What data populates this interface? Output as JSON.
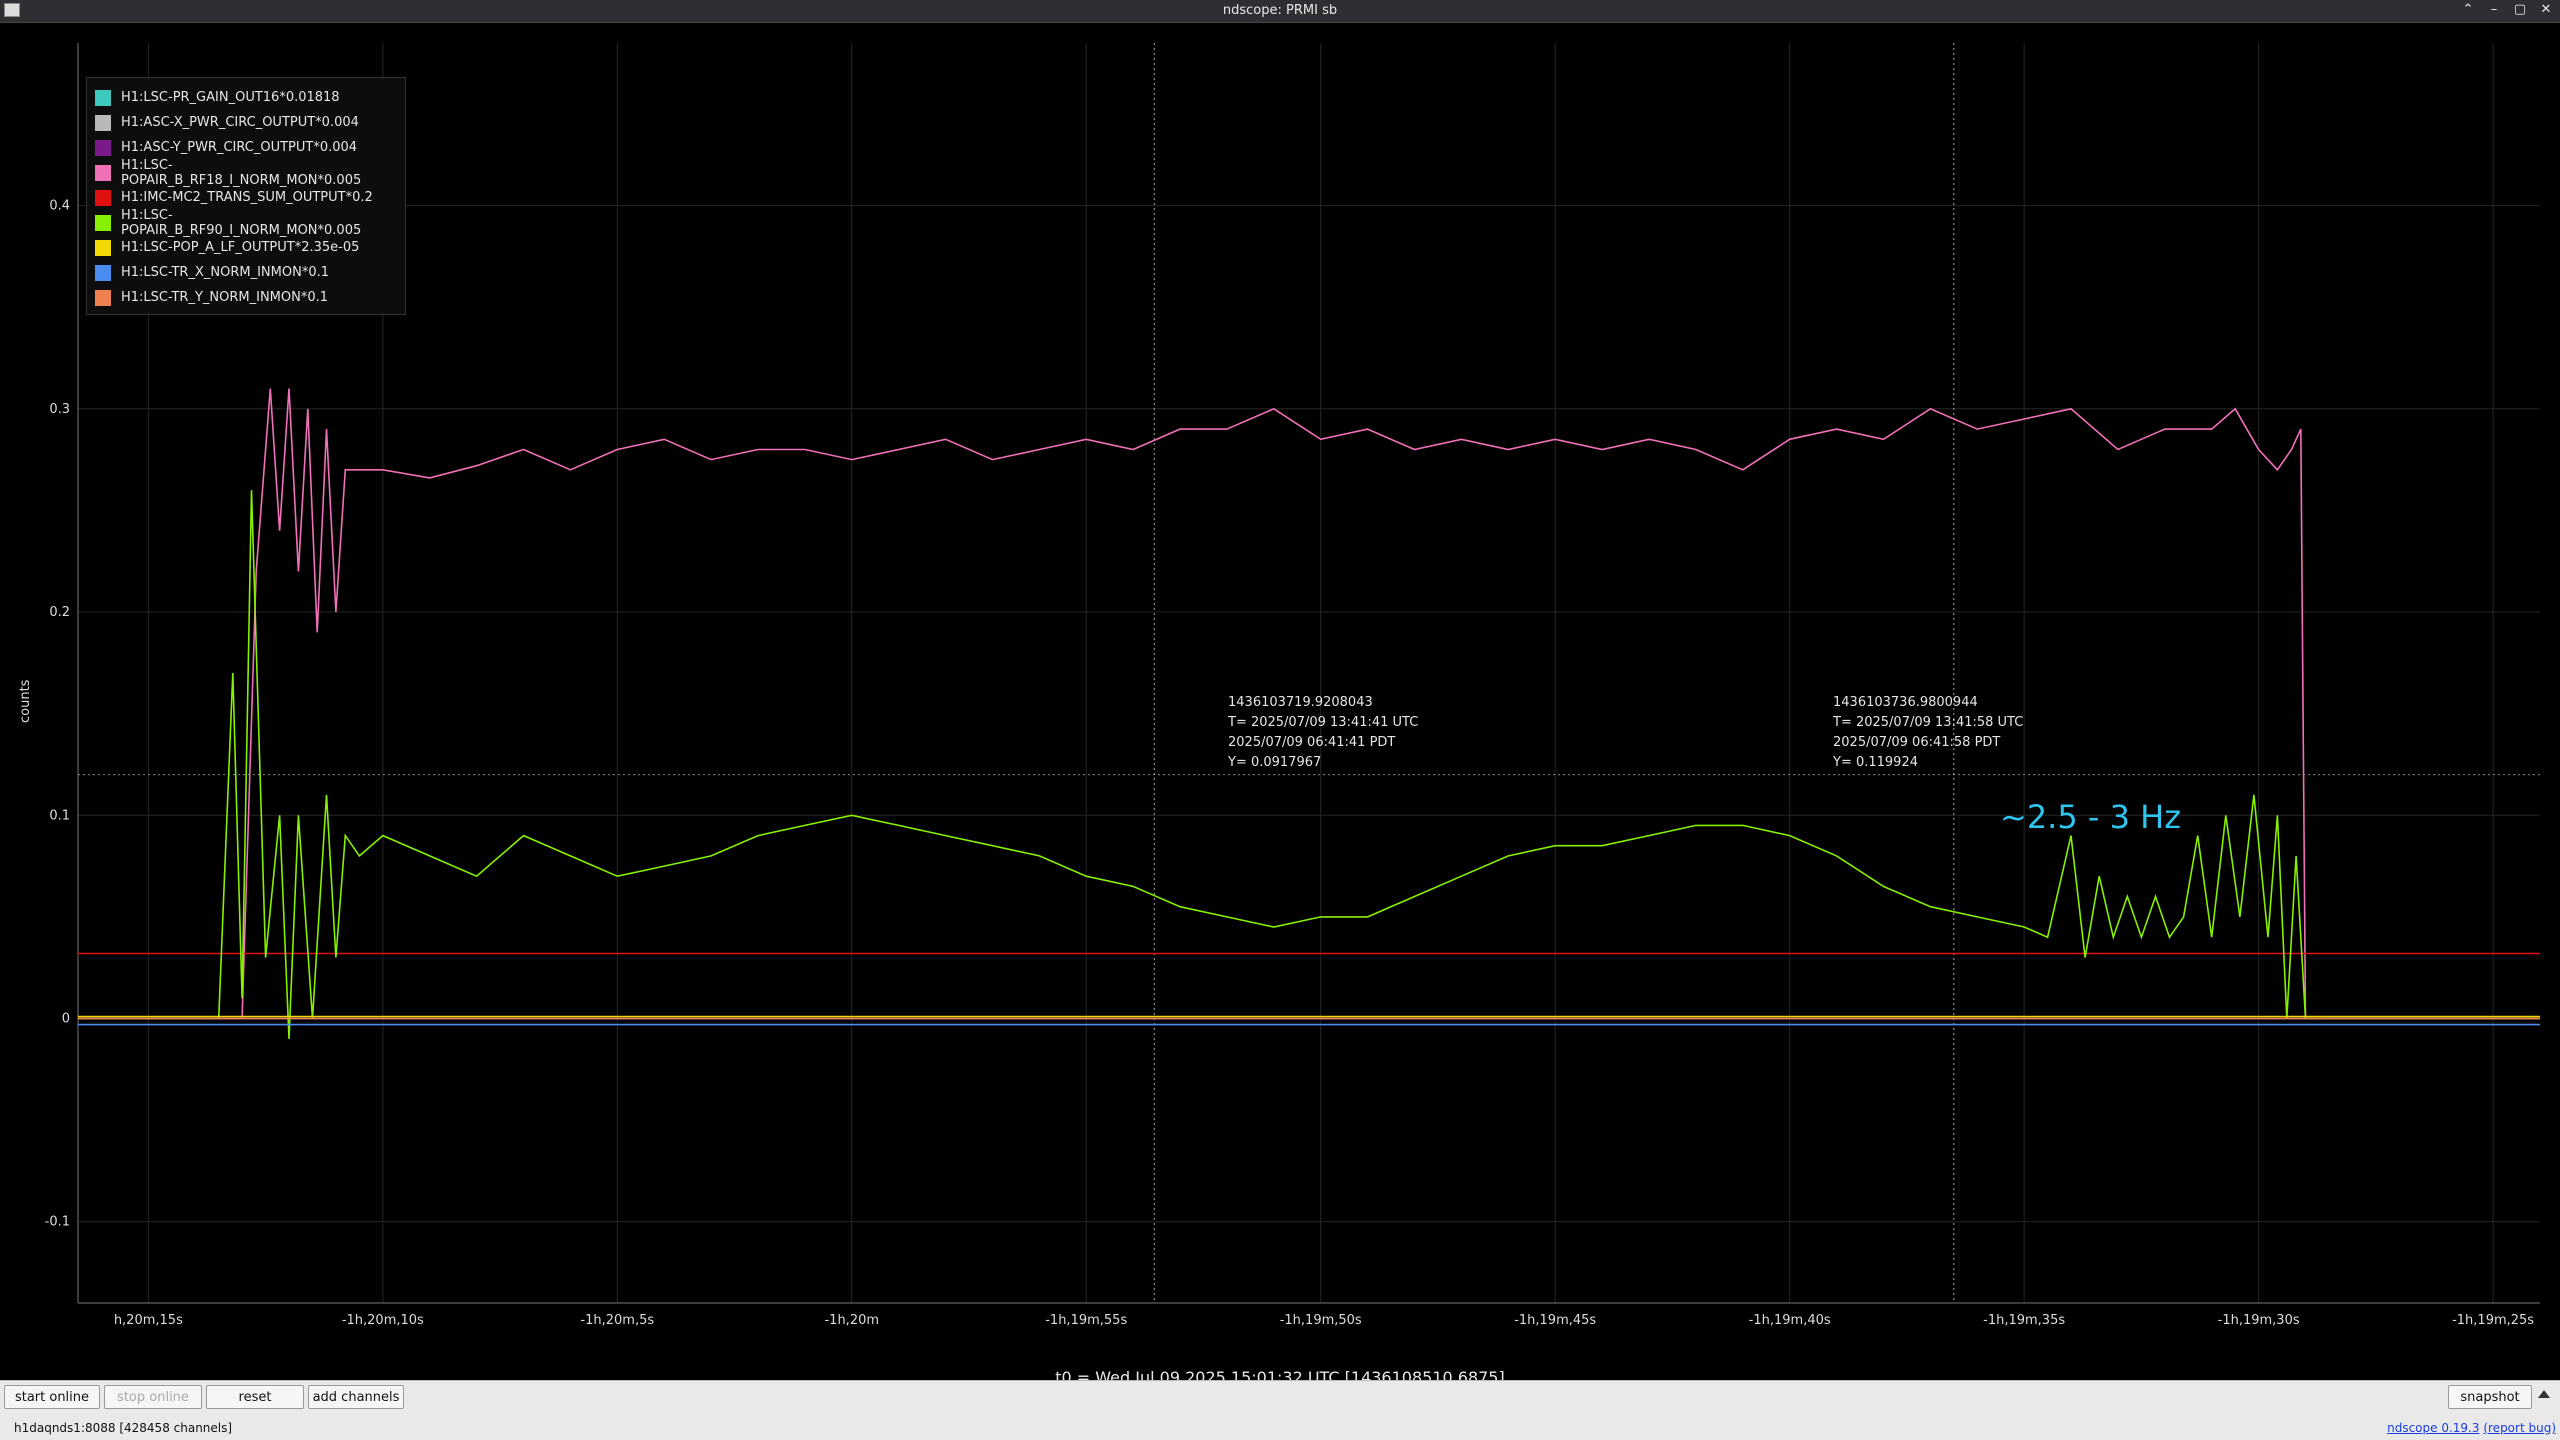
{
  "window": {
    "title": "ndscope: PRMI sb",
    "buttons": [
      "⌃",
      "–",
      "▢",
      "✕"
    ]
  },
  "chart_data": {
    "type": "line",
    "xlim": [
      -1216.5,
      -1164.0
    ],
    "ylim": [
      -0.14,
      0.48
    ],
    "ylabel": "counts",
    "yticks": [
      -0.1,
      0,
      0.1,
      0.2,
      0.3,
      0.4
    ],
    "ytick_labels": [
      "-0.1",
      "0",
      "0.1",
      "0.2",
      "0.3",
      "0.4"
    ],
    "xticks": [
      -1215,
      -1210,
      -1205,
      -1200,
      -1195,
      -1190,
      -1185,
      -1180,
      -1175,
      -1170,
      -1165
    ],
    "xtick_labels": [
      "h,20m,15s",
      "-1h,20m,10s",
      "-1h,20m,5s",
      "-1h,20m",
      "-1h,19m,55s",
      "-1h,19m,50s",
      "-1h,19m,45s",
      "-1h,19m,40s",
      "-1h,19m,35s",
      "-1h,19m,30s",
      "-1h,19m,25s"
    ],
    "grid": true,
    "legend_position": "top-left",
    "series": [
      {
        "name": "H1:LSC-PR_GAIN_OUT16*0.01818",
        "color": "#3ec9c0",
        "x": [
          -1216.5,
          -1164.0
        ],
        "y": [
          0.0,
          0.0
        ]
      },
      {
        "name": "H1:ASC-X_PWR_CIRC_OUTPUT*0.004",
        "color": "#b8b8b8",
        "x": [
          -1216.5,
          -1170.0,
          -1164.0
        ],
        "y": [
          0.0,
          0.0,
          0.0
        ]
      },
      {
        "name": "H1:ASC-Y_PWR_CIRC_OUTPUT*0.004",
        "color": "#7a1a8a",
        "x": [
          -1216.5,
          -1164.0
        ],
        "y": [
          0.0,
          0.0
        ]
      },
      {
        "name": "H1:LSC-POPAIR_B_RF18_I_NORM_MON*0.005",
        "color": "#f070b8",
        "x": [
          -1216.5,
          -1214.0,
          -1213.0,
          -1212.7,
          -1212.4,
          -1212.2,
          -1212.0,
          -1211.8,
          -1211.6,
          -1211.4,
          -1211.2,
          -1211.0,
          -1210.8,
          -1210.5,
          -1210.0,
          -1209.0,
          -1208.0,
          -1207.0,
          -1206.0,
          -1205.0,
          -1204.0,
          -1203.0,
          -1202.0,
          -1201.0,
          -1200.0,
          -1199.0,
          -1198.0,
          -1197.0,
          -1196.0,
          -1195.0,
          -1194.0,
          -1193.0,
          -1192.0,
          -1191.0,
          -1190.0,
          -1189.0,
          -1188.0,
          -1187.0,
          -1186.0,
          -1185.0,
          -1184.0,
          -1183.0,
          -1182.0,
          -1181.0,
          -1180.0,
          -1179.0,
          -1178.0,
          -1177.0,
          -1176.0,
          -1175.0,
          -1174.0,
          -1173.0,
          -1172.0,
          -1171.0,
          -1170.5,
          -1170.0,
          -1169.6,
          -1169.3,
          -1169.1,
          -1169.0,
          -1168.0,
          -1167.0,
          -1166.0,
          -1165.0,
          -1164.0
        ],
        "y": [
          0.0,
          0.0,
          0.0,
          0.22,
          0.31,
          0.24,
          0.31,
          0.22,
          0.3,
          0.19,
          0.29,
          0.2,
          0.27,
          0.27,
          0.27,
          0.266,
          0.272,
          0.28,
          0.27,
          0.28,
          0.285,
          0.275,
          0.28,
          0.28,
          0.275,
          0.28,
          0.285,
          0.275,
          0.28,
          0.285,
          0.28,
          0.29,
          0.29,
          0.3,
          0.285,
          0.29,
          0.28,
          0.285,
          0.28,
          0.285,
          0.28,
          0.285,
          0.28,
          0.27,
          0.285,
          0.29,
          0.285,
          0.3,
          0.29,
          0.295,
          0.3,
          0.28,
          0.29,
          0.29,
          0.3,
          0.28,
          0.27,
          0.28,
          0.29,
          0.0,
          0.0,
          0.0,
          0.0,
          0.0,
          0.0
        ]
      },
      {
        "name": "H1:IMC-MC2_TRANS_SUM_OUTPUT*0.2",
        "color": "#e01010",
        "x": [
          -1216.5,
          -1164.0
        ],
        "y": [
          0.032,
          0.032
        ]
      },
      {
        "name": "H1:LSC-POPAIR_B_RF90_I_NORM_MON*0.005",
        "color": "#86f000",
        "x": [
          -1216.5,
          -1213.5,
          -1213.2,
          -1213.0,
          -1212.8,
          -1212.5,
          -1212.2,
          -1212.0,
          -1211.8,
          -1211.5,
          -1211.2,
          -1211.0,
          -1210.8,
          -1210.5,
          -1210.0,
          -1209.0,
          -1208.0,
          -1207.0,
          -1206.0,
          -1205.0,
          -1204.0,
          -1203.0,
          -1202.0,
          -1201.0,
          -1200.0,
          -1199.0,
          -1198.0,
          -1197.0,
          -1196.0,
          -1195.0,
          -1194.0,
          -1193.0,
          -1192.0,
          -1191.0,
          -1190.0,
          -1189.0,
          -1188.0,
          -1187.0,
          -1186.0,
          -1185.0,
          -1184.0,
          -1183.0,
          -1182.0,
          -1181.0,
          -1180.0,
          -1179.0,
          -1178.0,
          -1177.0,
          -1176.0,
          -1175.0,
          -1174.5,
          -1174.0,
          -1173.7,
          -1173.4,
          -1173.1,
          -1172.8,
          -1172.5,
          -1172.2,
          -1171.9,
          -1171.6,
          -1171.3,
          -1171.0,
          -1170.7,
          -1170.4,
          -1170.1,
          -1169.8,
          -1169.6,
          -1169.4,
          -1169.2,
          -1169.0,
          -1168.0,
          -1167.0,
          -1166.0,
          -1165.0,
          -1164.0
        ],
        "y": [
          0.0,
          0.0,
          0.17,
          0.01,
          0.26,
          0.03,
          0.1,
          -0.01,
          0.1,
          0.0,
          0.11,
          0.03,
          0.09,
          0.08,
          0.09,
          0.08,
          0.07,
          0.09,
          0.08,
          0.07,
          0.075,
          0.08,
          0.09,
          0.095,
          0.1,
          0.095,
          0.09,
          0.085,
          0.08,
          0.07,
          0.065,
          0.055,
          0.05,
          0.045,
          0.05,
          0.05,
          0.06,
          0.07,
          0.08,
          0.085,
          0.085,
          0.09,
          0.095,
          0.095,
          0.09,
          0.08,
          0.065,
          0.055,
          0.05,
          0.045,
          0.04,
          0.09,
          0.03,
          0.07,
          0.04,
          0.06,
          0.04,
          0.06,
          0.04,
          0.05,
          0.09,
          0.04,
          0.1,
          0.05,
          0.11,
          0.04,
          0.1,
          0.0,
          0.08,
          0.0,
          0.0,
          0.0,
          0.0,
          0.0,
          0.0
        ]
      },
      {
        "name": "H1:LSC-POP_A_LF_OUTPUT*2.35e-05",
        "color": "#f0d800",
        "x": [
          -1216.5,
          -1164.0
        ],
        "y": [
          0.001,
          0.001
        ]
      },
      {
        "name": "H1:LSC-TR_X_NORM_INMON*0.1",
        "color": "#4a8cf0",
        "x": [
          -1216.5,
          -1164.0
        ],
        "y": [
          -0.003,
          -0.003
        ]
      },
      {
        "name": "H1:LSC-TR_Y_NORM_INMON*0.1",
        "color": "#f08050",
        "x": [
          -1216.5,
          -1164.0
        ],
        "y": [
          0.0,
          0.0
        ]
      }
    ],
    "cursors": [
      {
        "x": -1193.55,
        "label": "1436103719.9208043\nT= 2025/07/09 13:41:41 UTC\n2025/07/09 06:41:41 PDT\nY= 0.0917967"
      },
      {
        "x": -1176.5,
        "label": "1436103736.9800944\nT= 2025/07/09 13:41:58 UTC\n2025/07/09 06:41:58 PDT\nY= 0.119924"
      }
    ],
    "hline": {
      "y": 0.12
    },
    "annotation": "~2.5 - 3 Hz",
    "t0": "t0 = Wed Jul 09 2025 15:01:32 UTC [1436108510.6875]"
  },
  "toolbar": {
    "start_online": "start online",
    "stop_online": "stop online",
    "reset": "reset",
    "add_channels": "add channels",
    "snapshot": "snapshot"
  },
  "status": {
    "server": "h1daqnds1:8088  [428458 channels]",
    "version_link": "ndscope 0.19.3",
    "report_bug": "(report bug)"
  }
}
